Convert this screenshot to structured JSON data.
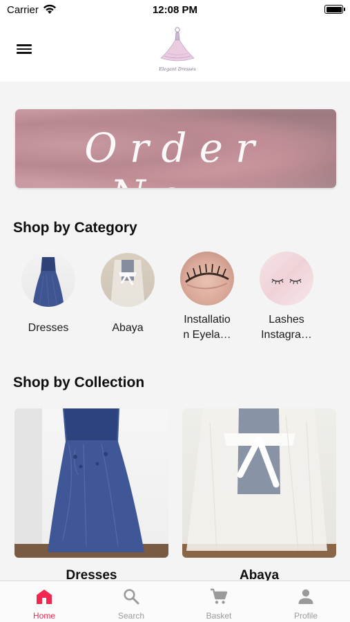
{
  "status_bar": {
    "carrier": "Carrier",
    "time": "12:08 PM"
  },
  "header": {
    "logo_icon": "dress-logo-icon",
    "menu_icon": "hamburger-menu-icon"
  },
  "banner": {
    "text": "Order Now"
  },
  "categories": {
    "title": "Shop by Category",
    "items": [
      {
        "label": "Dresses"
      },
      {
        "label": "Abaya"
      },
      {
        "label": "Installatio\nn Eyela…"
      },
      {
        "label": "Lashes\nInstagra…"
      }
    ]
  },
  "collections": {
    "title": "Shop by Collection",
    "items": [
      {
        "label": "Dresses"
      },
      {
        "label": "Abaya"
      }
    ]
  },
  "tabbar": {
    "accent": "#f2264f",
    "inactive": "#9a9a9a",
    "tabs": [
      {
        "label": "Home",
        "icon": "home-icon",
        "active": true
      },
      {
        "label": "Search",
        "icon": "search-icon",
        "active": false
      },
      {
        "label": "Basket",
        "icon": "cart-icon",
        "active": false
      },
      {
        "label": "Profile",
        "icon": "user-icon",
        "active": false
      }
    ]
  }
}
